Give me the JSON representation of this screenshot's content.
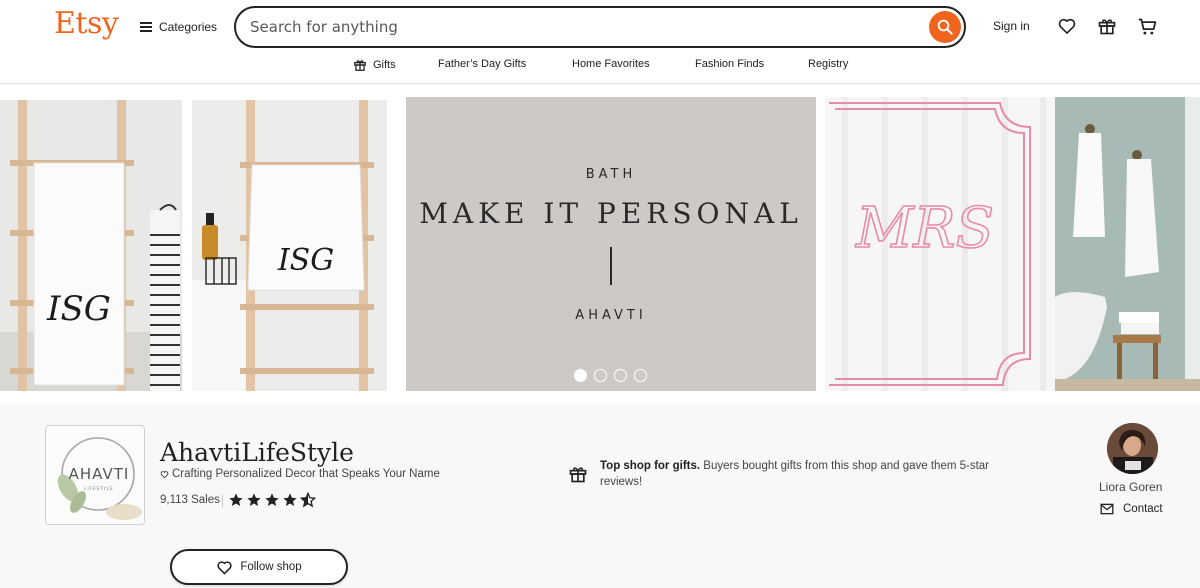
{
  "header": {
    "logo": "Etsy",
    "categories_label": "Categories",
    "search_placeholder": "Search for anything",
    "search_value": "",
    "sign_in_label": "Sign in",
    "icons": [
      "hamburger-icon",
      "search-icon",
      "heart-icon",
      "gift-icon",
      "cart-icon"
    ]
  },
  "nav": {
    "items": [
      {
        "label": "Gifts",
        "icon": "gift-icon"
      },
      {
        "label": "Father’s Day Gifts"
      },
      {
        "label": "Home Favorites"
      },
      {
        "label": "Fashion Finds"
      },
      {
        "label": "Registry"
      }
    ]
  },
  "banner": {
    "small_top": "BATH",
    "headline": "MAKE IT PERSONAL",
    "small_bottom": "AHAVTI",
    "monogram_left": "ISG",
    "monogram_mid": "ISG",
    "monogram_right": "MRS",
    "slide_count": 4,
    "active_slide": 1
  },
  "shop": {
    "logo_text": "AHAVTI",
    "logo_subtext": "LIFESTYLE",
    "name": "AhavtiLifeStyle",
    "tagline": "Crafting Personalized Decor that Speaks Your Name",
    "sales": "9,113 Sales",
    "rating": 4.5,
    "rating_max": 5,
    "gift_note_bold": "Top shop for gifts.",
    "gift_note_text": " Buyers bought gifts from this shop and gave them 5-star reviews!",
    "owner_name": "Liora Goren",
    "contact_label": "Contact",
    "follow_label": "Follow shop"
  },
  "colors": {
    "brand": "#f1641e",
    "text": "#222222",
    "banner_center_bg": "#cdc9c6",
    "shop_section_bg": "#f8f8f8",
    "monogram_pink": "#e98aa6"
  }
}
